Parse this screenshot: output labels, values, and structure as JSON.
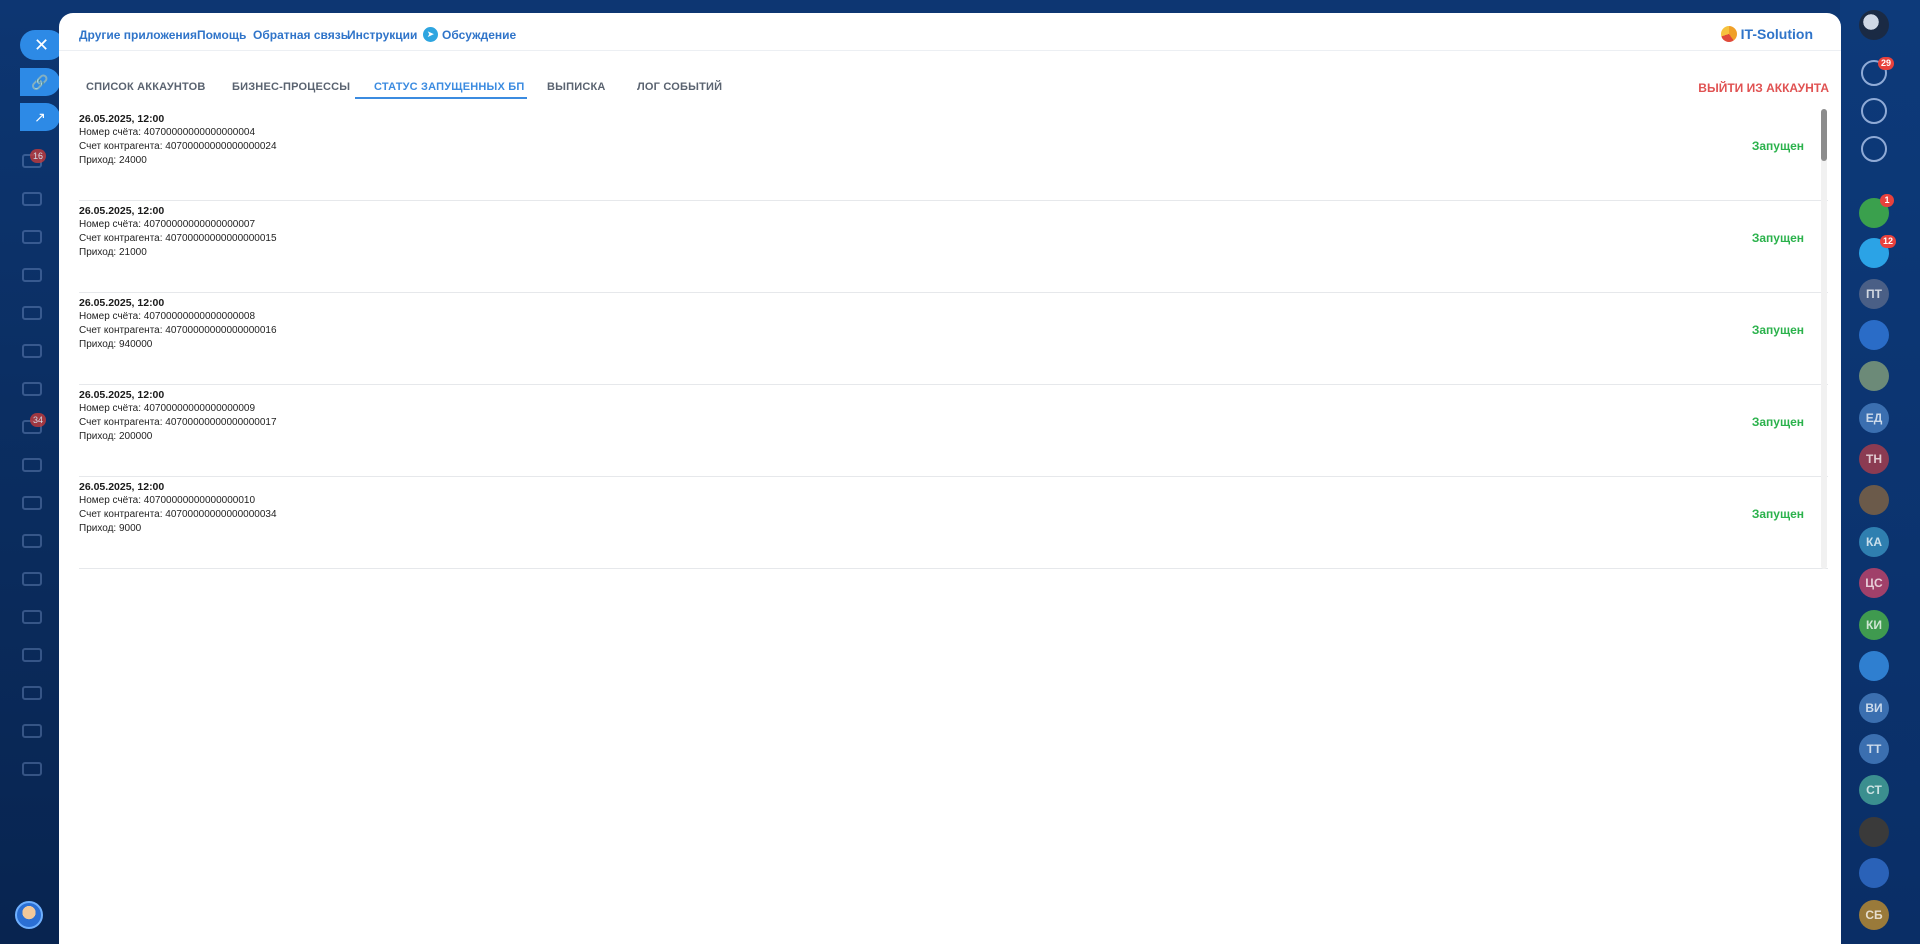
{
  "background": {
    "left_badges": [
      "16",
      "34"
    ]
  },
  "topbar": {
    "links": [
      "Другие приложения",
      "Помощь",
      "Обратная связь",
      "Инструкции",
      "Обсуждение"
    ],
    "brand": "IT-Solution"
  },
  "tabs": {
    "items": [
      "СПИСОК АККАУНТОВ",
      "БИЗНЕС-ПРОЦЕССЫ",
      "СТАТУС ЗАПУЩЕННЫХ БП",
      "ВЫПИСКА",
      "ЛОГ СОБЫТИЙ"
    ],
    "active_index": 2,
    "logout": "ВЫЙТИ ИЗ АККАУНТА"
  },
  "entries": [
    {
      "date": "26.05.2025, 12:00",
      "account": "Номер счёта: 40700000000000000004",
      "counterparty": "Счет контрагента: 40700000000000000024",
      "income": "Приход: 24000",
      "status": "Запущен"
    },
    {
      "date": "26.05.2025, 12:00",
      "account": "Номер счёта: 40700000000000000007",
      "counterparty": "Счет контрагента: 40700000000000000015",
      "income": "Приход: 21000",
      "status": "Запущен"
    },
    {
      "date": "26.05.2025, 12:00",
      "account": "Номер счёта: 40700000000000000008",
      "counterparty": "Счет контрагента: 40700000000000000016",
      "income": "Приход: 940000",
      "status": "Запущен"
    },
    {
      "date": "26.05.2025, 12:00",
      "account": "Номер счёта: 40700000000000000009",
      "counterparty": "Счет контрагента: 40700000000000000017",
      "income": "Приход: 200000",
      "status": "Запущен"
    },
    {
      "date": "26.05.2025, 12:00",
      "account": "Номер счёта: 40700000000000000010",
      "counterparty": "Счет контрагента: 40700000000000000034",
      "income": "Приход: 9000",
      "status": "Запущен"
    }
  ],
  "rail": {
    "badges": [
      "29",
      "1",
      "12"
    ],
    "initials": [
      "ПТ",
      "ЕД",
      "ТН",
      "КА",
      "ЦС",
      "КИ",
      "ВИ",
      "ТТ",
      "СТ",
      "СБ"
    ]
  },
  "colors": {
    "accent": "#3b8be0",
    "link": "#2f74c9",
    "status_ok": "#2bb24c",
    "logout": "#e05252"
  }
}
